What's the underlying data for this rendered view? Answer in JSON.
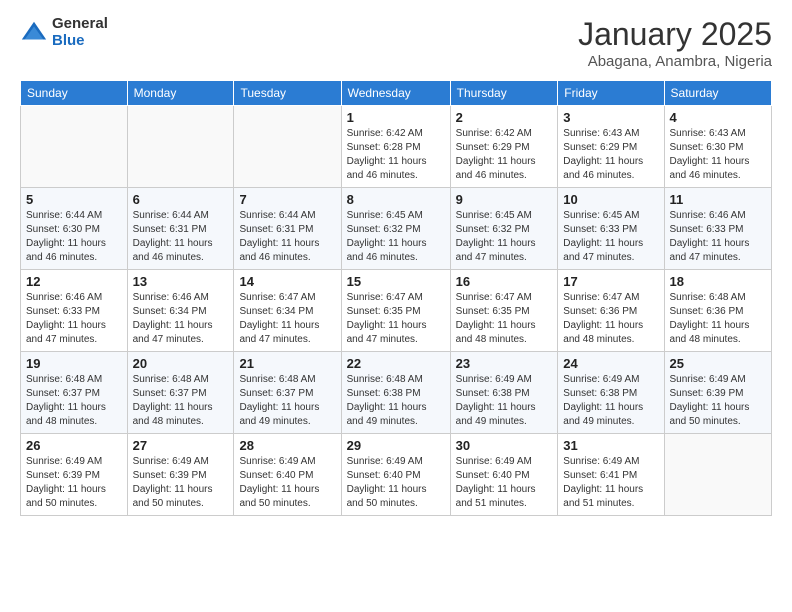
{
  "logo": {
    "general": "General",
    "blue": "Blue"
  },
  "header": {
    "title": "January 2025",
    "location": "Abagana, Anambra, Nigeria"
  },
  "days": [
    "Sunday",
    "Monday",
    "Tuesday",
    "Wednesday",
    "Thursday",
    "Friday",
    "Saturday"
  ],
  "weeks": [
    [
      {
        "day": "",
        "info": ""
      },
      {
        "day": "",
        "info": ""
      },
      {
        "day": "",
        "info": ""
      },
      {
        "day": "1",
        "info": "Sunrise: 6:42 AM\nSunset: 6:28 PM\nDaylight: 11 hours\nand 46 minutes."
      },
      {
        "day": "2",
        "info": "Sunrise: 6:42 AM\nSunset: 6:29 PM\nDaylight: 11 hours\nand 46 minutes."
      },
      {
        "day": "3",
        "info": "Sunrise: 6:43 AM\nSunset: 6:29 PM\nDaylight: 11 hours\nand 46 minutes."
      },
      {
        "day": "4",
        "info": "Sunrise: 6:43 AM\nSunset: 6:30 PM\nDaylight: 11 hours\nand 46 minutes."
      }
    ],
    [
      {
        "day": "5",
        "info": "Sunrise: 6:44 AM\nSunset: 6:30 PM\nDaylight: 11 hours\nand 46 minutes."
      },
      {
        "day": "6",
        "info": "Sunrise: 6:44 AM\nSunset: 6:31 PM\nDaylight: 11 hours\nand 46 minutes."
      },
      {
        "day": "7",
        "info": "Sunrise: 6:44 AM\nSunset: 6:31 PM\nDaylight: 11 hours\nand 46 minutes."
      },
      {
        "day": "8",
        "info": "Sunrise: 6:45 AM\nSunset: 6:32 PM\nDaylight: 11 hours\nand 46 minutes."
      },
      {
        "day": "9",
        "info": "Sunrise: 6:45 AM\nSunset: 6:32 PM\nDaylight: 11 hours\nand 47 minutes."
      },
      {
        "day": "10",
        "info": "Sunrise: 6:45 AM\nSunset: 6:33 PM\nDaylight: 11 hours\nand 47 minutes."
      },
      {
        "day": "11",
        "info": "Sunrise: 6:46 AM\nSunset: 6:33 PM\nDaylight: 11 hours\nand 47 minutes."
      }
    ],
    [
      {
        "day": "12",
        "info": "Sunrise: 6:46 AM\nSunset: 6:33 PM\nDaylight: 11 hours\nand 47 minutes."
      },
      {
        "day": "13",
        "info": "Sunrise: 6:46 AM\nSunset: 6:34 PM\nDaylight: 11 hours\nand 47 minutes."
      },
      {
        "day": "14",
        "info": "Sunrise: 6:47 AM\nSunset: 6:34 PM\nDaylight: 11 hours\nand 47 minutes."
      },
      {
        "day": "15",
        "info": "Sunrise: 6:47 AM\nSunset: 6:35 PM\nDaylight: 11 hours\nand 47 minutes."
      },
      {
        "day": "16",
        "info": "Sunrise: 6:47 AM\nSunset: 6:35 PM\nDaylight: 11 hours\nand 48 minutes."
      },
      {
        "day": "17",
        "info": "Sunrise: 6:47 AM\nSunset: 6:36 PM\nDaylight: 11 hours\nand 48 minutes."
      },
      {
        "day": "18",
        "info": "Sunrise: 6:48 AM\nSunset: 6:36 PM\nDaylight: 11 hours\nand 48 minutes."
      }
    ],
    [
      {
        "day": "19",
        "info": "Sunrise: 6:48 AM\nSunset: 6:37 PM\nDaylight: 11 hours\nand 48 minutes."
      },
      {
        "day": "20",
        "info": "Sunrise: 6:48 AM\nSunset: 6:37 PM\nDaylight: 11 hours\nand 48 minutes."
      },
      {
        "day": "21",
        "info": "Sunrise: 6:48 AM\nSunset: 6:37 PM\nDaylight: 11 hours\nand 49 minutes."
      },
      {
        "day": "22",
        "info": "Sunrise: 6:48 AM\nSunset: 6:38 PM\nDaylight: 11 hours\nand 49 minutes."
      },
      {
        "day": "23",
        "info": "Sunrise: 6:49 AM\nSunset: 6:38 PM\nDaylight: 11 hours\nand 49 minutes."
      },
      {
        "day": "24",
        "info": "Sunrise: 6:49 AM\nSunset: 6:38 PM\nDaylight: 11 hours\nand 49 minutes."
      },
      {
        "day": "25",
        "info": "Sunrise: 6:49 AM\nSunset: 6:39 PM\nDaylight: 11 hours\nand 50 minutes."
      }
    ],
    [
      {
        "day": "26",
        "info": "Sunrise: 6:49 AM\nSunset: 6:39 PM\nDaylight: 11 hours\nand 50 minutes."
      },
      {
        "day": "27",
        "info": "Sunrise: 6:49 AM\nSunset: 6:39 PM\nDaylight: 11 hours\nand 50 minutes."
      },
      {
        "day": "28",
        "info": "Sunrise: 6:49 AM\nSunset: 6:40 PM\nDaylight: 11 hours\nand 50 minutes."
      },
      {
        "day": "29",
        "info": "Sunrise: 6:49 AM\nSunset: 6:40 PM\nDaylight: 11 hours\nand 50 minutes."
      },
      {
        "day": "30",
        "info": "Sunrise: 6:49 AM\nSunset: 6:40 PM\nDaylight: 11 hours\nand 51 minutes."
      },
      {
        "day": "31",
        "info": "Sunrise: 6:49 AM\nSunset: 6:41 PM\nDaylight: 11 hours\nand 51 minutes."
      },
      {
        "day": "",
        "info": ""
      }
    ]
  ]
}
